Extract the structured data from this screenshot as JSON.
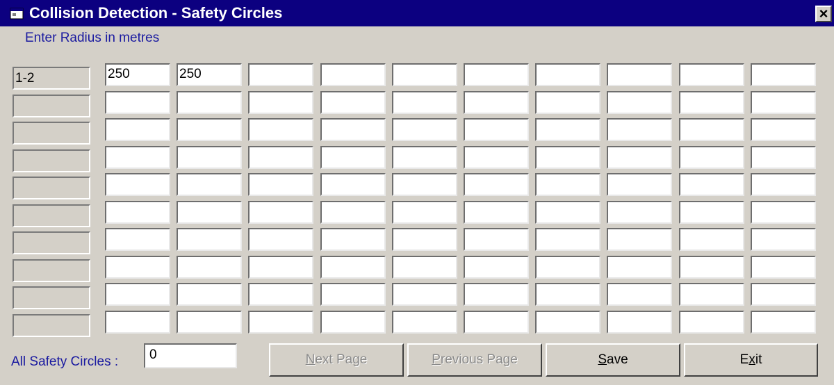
{
  "window": {
    "title": "Collision Detection - Safety Circles",
    "close_glyph": "×"
  },
  "instruction": "Enter Radius in metres",
  "grid": {
    "row_labels": [
      "1-2",
      "",
      "",
      "",
      "",
      "",
      "",
      "",
      "",
      ""
    ],
    "rows": [
      [
        "250",
        "250",
        "",
        "",
        "",
        "",
        "",
        "",
        "",
        ""
      ],
      [
        "",
        "",
        "",
        "",
        "",
        "",
        "",
        "",
        "",
        ""
      ],
      [
        "",
        "",
        "",
        "",
        "",
        "",
        "",
        "",
        "",
        ""
      ],
      [
        "",
        "",
        "",
        "",
        "",
        "",
        "",
        "",
        "",
        ""
      ],
      [
        "",
        "",
        "",
        "",
        "",
        "",
        "",
        "",
        "",
        ""
      ],
      [
        "",
        "",
        "",
        "",
        "",
        "",
        "",
        "",
        "",
        ""
      ],
      [
        "",
        "",
        "",
        "",
        "",
        "",
        "",
        "",
        "",
        ""
      ],
      [
        "",
        "",
        "",
        "",
        "",
        "",
        "",
        "",
        "",
        ""
      ],
      [
        "",
        "",
        "",
        "",
        "",
        "",
        "",
        "",
        "",
        ""
      ],
      [
        "",
        "",
        "",
        "",
        "",
        "",
        "",
        "",
        "",
        ""
      ]
    ]
  },
  "all_safety_circles": {
    "label": "All Safety Circles :",
    "value": "0"
  },
  "buttons": {
    "next_page": {
      "accel": "N",
      "rest": "ext Page",
      "enabled": false
    },
    "previous_page": {
      "accel": "P",
      "rest": "revious Page",
      "enabled": false
    },
    "save": {
      "accel": "S",
      "rest": "ave",
      "enabled": true
    },
    "exit": {
      "before": "E",
      "accel": "x",
      "rest": "it",
      "enabled": true
    }
  },
  "icons": {
    "title_icon": "window-app-icon",
    "close_icon": "close-icon"
  },
  "colors": {
    "titlebar": "#0c0080",
    "face": "#d4d0c8",
    "label_text": "#1a1aa0"
  }
}
